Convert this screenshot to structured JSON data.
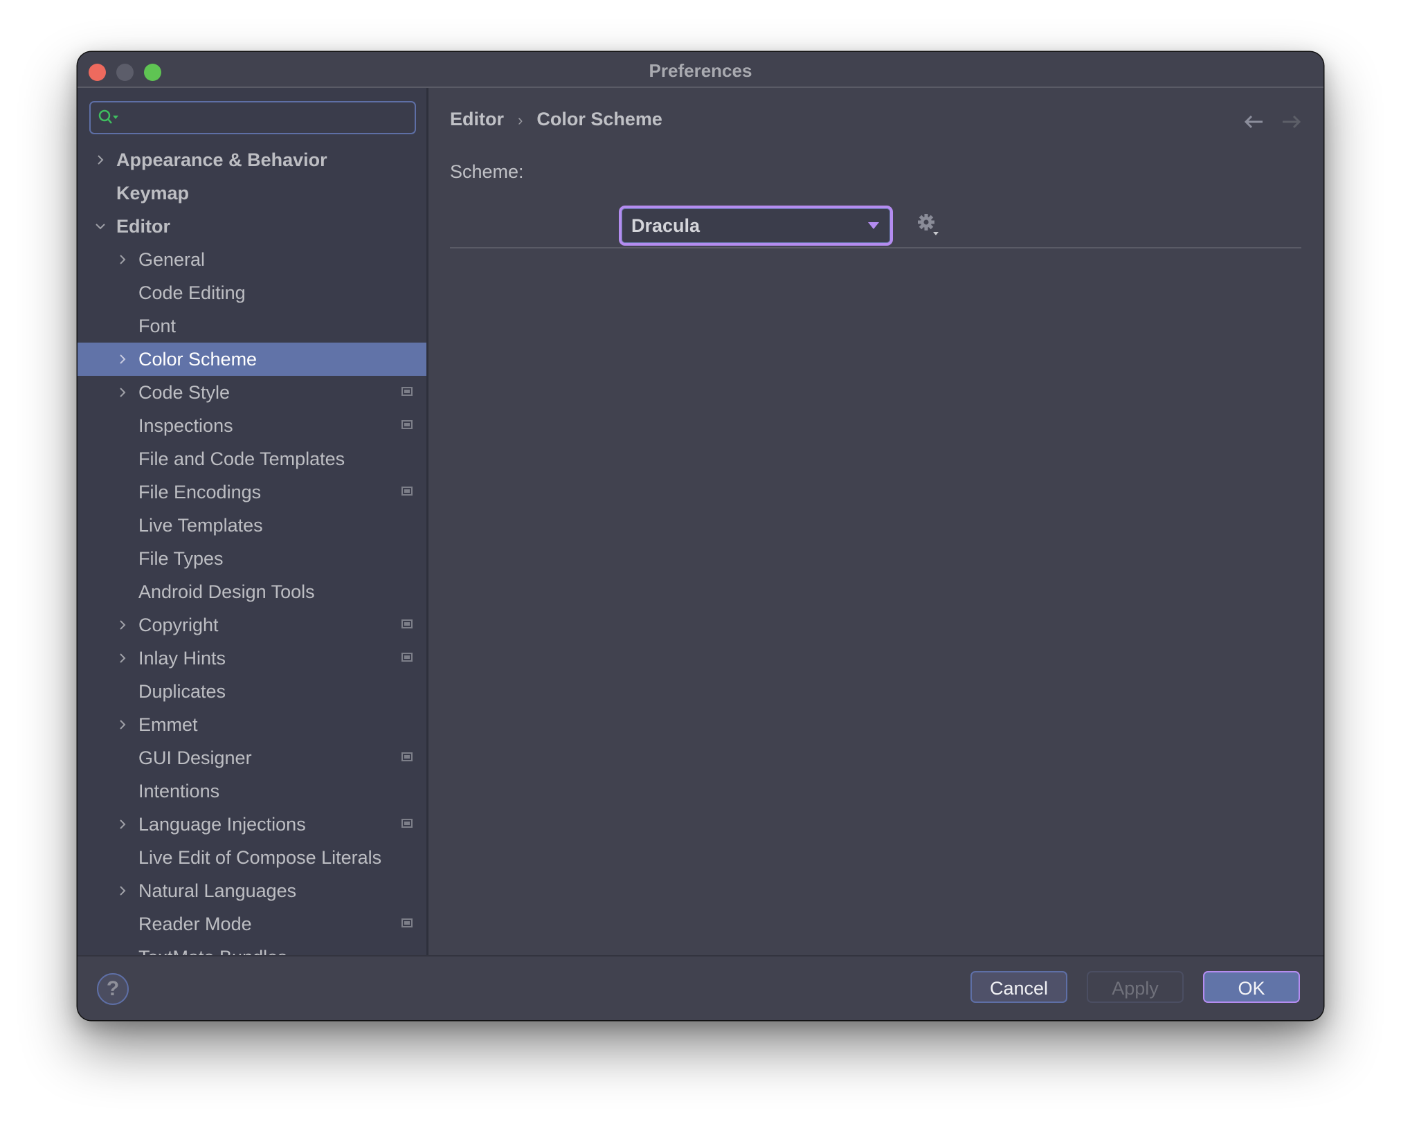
{
  "window": {
    "title": "Preferences",
    "traffic_lights": [
      "close",
      "minimize",
      "maximize"
    ]
  },
  "search": {
    "value": "",
    "placeholder": "",
    "icon": "search-icon"
  },
  "tree": [
    {
      "label": "Appearance & Behavior",
      "level": 0,
      "bold": true,
      "chevron": "right",
      "badge": false,
      "selected": false
    },
    {
      "label": "Keymap",
      "level": 0,
      "bold": true,
      "chevron": "none",
      "badge": false,
      "selected": false
    },
    {
      "label": "Editor",
      "level": 0,
      "bold": true,
      "chevron": "down",
      "badge": false,
      "selected": false
    },
    {
      "label": "General",
      "level": 1,
      "bold": false,
      "chevron": "right",
      "badge": false,
      "selected": false
    },
    {
      "label": "Code Editing",
      "level": 1,
      "bold": false,
      "chevron": "none",
      "badge": false,
      "selected": false
    },
    {
      "label": "Font",
      "level": 1,
      "bold": false,
      "chevron": "none",
      "badge": false,
      "selected": false
    },
    {
      "label": "Color Scheme",
      "level": 1,
      "bold": false,
      "chevron": "right",
      "badge": false,
      "selected": true
    },
    {
      "label": "Code Style",
      "level": 1,
      "bold": false,
      "chevron": "right",
      "badge": true,
      "selected": false
    },
    {
      "label": "Inspections",
      "level": 1,
      "bold": false,
      "chevron": "none",
      "badge": true,
      "selected": false
    },
    {
      "label": "File and Code Templates",
      "level": 1,
      "bold": false,
      "chevron": "none",
      "badge": false,
      "selected": false
    },
    {
      "label": "File Encodings",
      "level": 1,
      "bold": false,
      "chevron": "none",
      "badge": true,
      "selected": false
    },
    {
      "label": "Live Templates",
      "level": 1,
      "bold": false,
      "chevron": "none",
      "badge": false,
      "selected": false
    },
    {
      "label": "File Types",
      "level": 1,
      "bold": false,
      "chevron": "none",
      "badge": false,
      "selected": false
    },
    {
      "label": "Android Design Tools",
      "level": 1,
      "bold": false,
      "chevron": "none",
      "badge": false,
      "selected": false
    },
    {
      "label": "Copyright",
      "level": 1,
      "bold": false,
      "chevron": "right",
      "badge": true,
      "selected": false
    },
    {
      "label": "Inlay Hints",
      "level": 1,
      "bold": false,
      "chevron": "right",
      "badge": true,
      "selected": false
    },
    {
      "label": "Duplicates",
      "level": 1,
      "bold": false,
      "chevron": "none",
      "badge": false,
      "selected": false
    },
    {
      "label": "Emmet",
      "level": 1,
      "bold": false,
      "chevron": "right",
      "badge": false,
      "selected": false
    },
    {
      "label": "GUI Designer",
      "level": 1,
      "bold": false,
      "chevron": "none",
      "badge": true,
      "selected": false
    },
    {
      "label": "Intentions",
      "level": 1,
      "bold": false,
      "chevron": "none",
      "badge": false,
      "selected": false
    },
    {
      "label": "Language Injections",
      "level": 1,
      "bold": false,
      "chevron": "right",
      "badge": true,
      "selected": false
    },
    {
      "label": "Live Edit of Compose Literals",
      "level": 1,
      "bold": false,
      "chevron": "none",
      "badge": false,
      "selected": false
    },
    {
      "label": "Natural Languages",
      "level": 1,
      "bold": false,
      "chevron": "right",
      "badge": false,
      "selected": false
    },
    {
      "label": "Reader Mode",
      "level": 1,
      "bold": false,
      "chevron": "none",
      "badge": true,
      "selected": false
    },
    {
      "label": "TextMate Bundles",
      "level": 1,
      "bold": false,
      "chevron": "none",
      "badge": false,
      "selected": false
    }
  ],
  "content": {
    "breadcrumb": [
      "Editor",
      "Color Scheme"
    ],
    "breadcrumb_separator": "›",
    "scheme_label": "Scheme:",
    "scheme_value": "Dracula",
    "nav": {
      "back_enabled": true,
      "forward_enabled": false
    }
  },
  "footer": {
    "help_label": "?",
    "cancel_label": "Cancel",
    "apply_label": "Apply",
    "apply_enabled": false,
    "ok_label": "OK"
  },
  "colors": {
    "accent": "#b48cf0",
    "selection": "#6173a8",
    "focus_border": "#5e6fa6",
    "search_icon": "#3fbf5f"
  }
}
